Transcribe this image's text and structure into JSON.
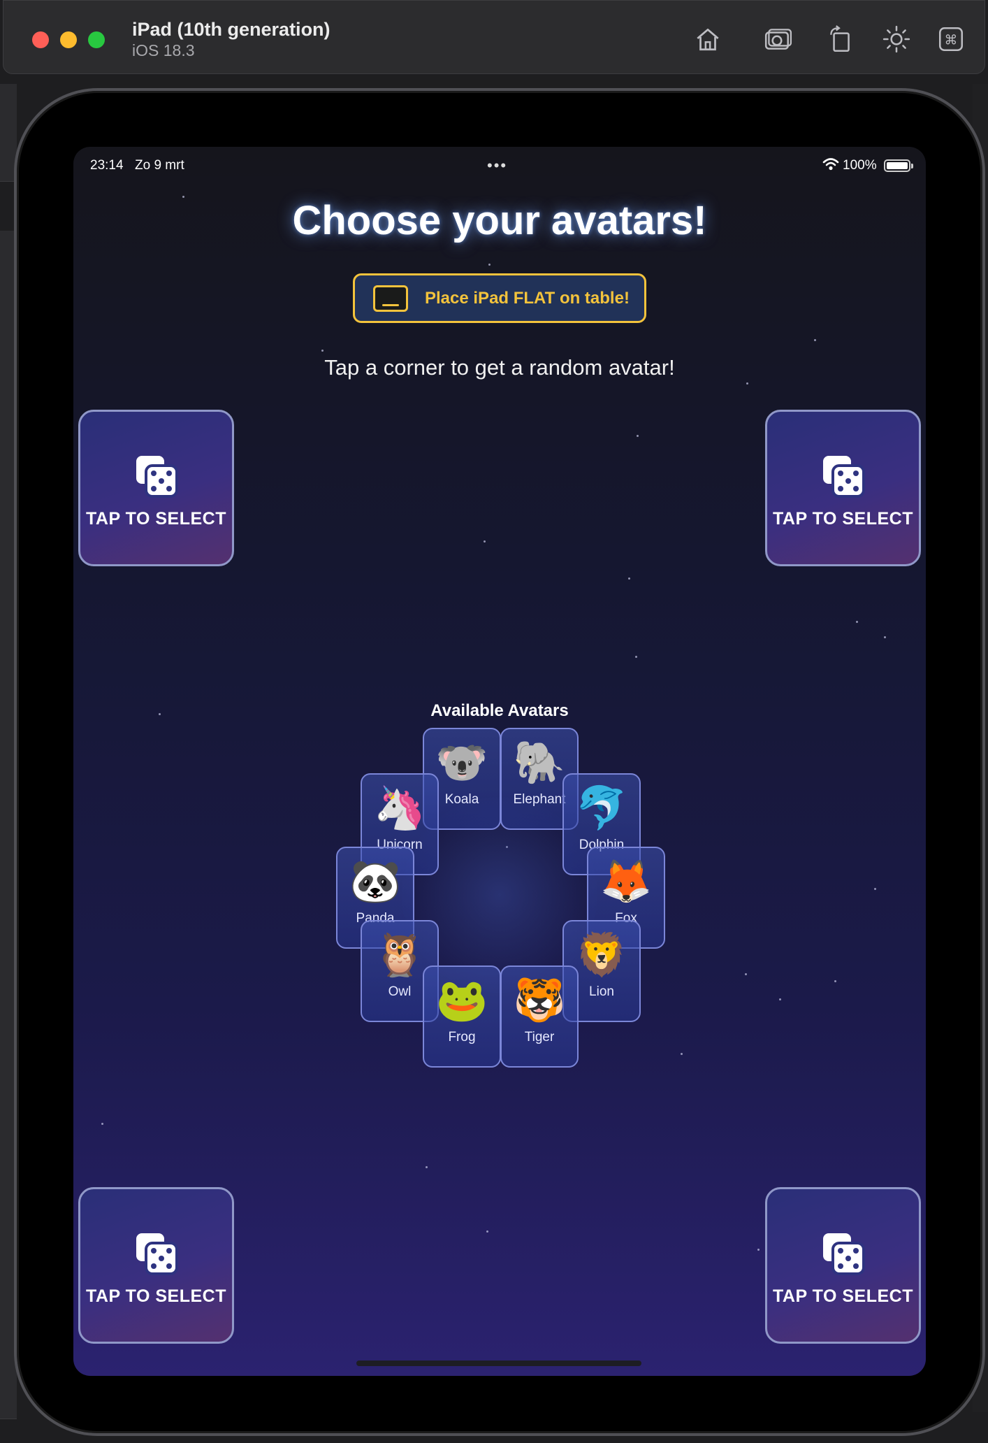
{
  "simulator": {
    "device_name": "iPad (10th generation)",
    "os_version": "iOS 18.3",
    "toolbar_icons": [
      "home-icon",
      "screenshot-icon",
      "rotate-icon",
      "appearance-icon",
      "keyboard-command-icon"
    ]
  },
  "status_bar": {
    "time": "23:14",
    "date": "Zo 9 mrt",
    "multitask": "•••",
    "battery": "100%"
  },
  "screen": {
    "title": "Choose your avatars!",
    "banner": "Place iPad FLAT on table!",
    "instruction": "Tap a corner to get a random avatar!",
    "corner_label": "TAP TO SELECT",
    "corners": [
      {
        "label": "TAP TO SELECT",
        "icon": "dice-icon"
      },
      {
        "label": "TAP TO SELECT",
        "icon": "dice-icon"
      },
      {
        "label": "TAP TO SELECT",
        "icon": "dice-icon"
      },
      {
        "label": "TAP TO SELECT",
        "icon": "dice-icon"
      }
    ],
    "avatars_title": "Available Avatars",
    "avatars": [
      {
        "name": "Koala",
        "emoji": "🐨"
      },
      {
        "name": "Elephant",
        "emoji": "🐘"
      },
      {
        "name": "Unicorn",
        "emoji": "🦄"
      },
      {
        "name": "Dolphin",
        "emoji": "🐬"
      },
      {
        "name": "Panda",
        "emoji": "🐼"
      },
      {
        "name": "Fox",
        "emoji": "🦊"
      },
      {
        "name": "Owl",
        "emoji": "🦉"
      },
      {
        "name": "Lion",
        "emoji": "🦁"
      },
      {
        "name": "Frog",
        "emoji": "🐸"
      },
      {
        "name": "Tiger",
        "emoji": "🐯"
      }
    ]
  },
  "colors": {
    "banner_accent": "#f3c33c",
    "title_glow": "#78aaff",
    "corner_border": "#9098c8",
    "avatar_border": "#7b86d8"
  }
}
